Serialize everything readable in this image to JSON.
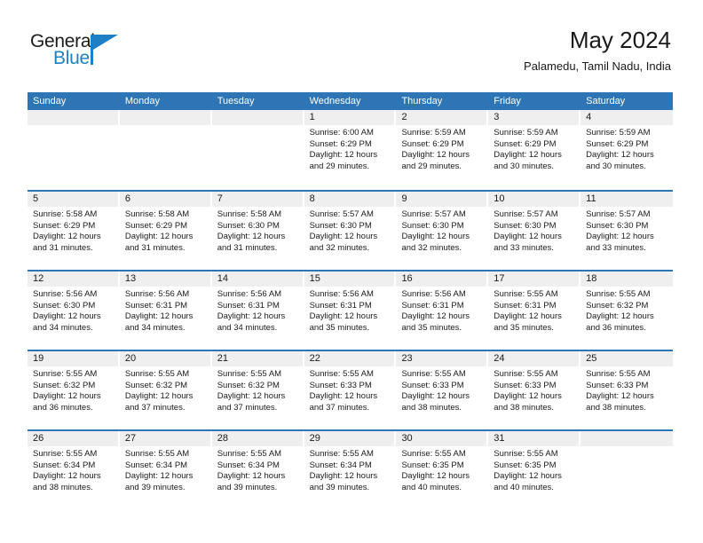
{
  "brand": {
    "name_top": "General",
    "name_bottom": "Blue",
    "accent_color": "#1f7fc4",
    "flag_icon": "triangle-flag-icon"
  },
  "header": {
    "title": "May 2024",
    "subtitle": "Palamedu, Tamil Nadu, India"
  },
  "theme": {
    "header_blue": "#2e75b6",
    "daynum_band": "#efefef",
    "text": "#1a1a1a"
  },
  "calendar": {
    "weekday_headers": [
      "Sunday",
      "Monday",
      "Tuesday",
      "Wednesday",
      "Thursday",
      "Friday",
      "Saturday"
    ],
    "weeks": [
      [
        {
          "day": "",
          "empty": true,
          "sunrise": "",
          "sunset": "",
          "daylight_line1": "",
          "daylight_line2": ""
        },
        {
          "day": "",
          "empty": true,
          "sunrise": "",
          "sunset": "",
          "daylight_line1": "",
          "daylight_line2": ""
        },
        {
          "day": "",
          "empty": true,
          "sunrise": "",
          "sunset": "",
          "daylight_line1": "",
          "daylight_line2": ""
        },
        {
          "day": "1",
          "sunrise": "Sunrise: 6:00 AM",
          "sunset": "Sunset: 6:29 PM",
          "daylight_line1": "Daylight: 12 hours",
          "daylight_line2": "and 29 minutes."
        },
        {
          "day": "2",
          "sunrise": "Sunrise: 5:59 AM",
          "sunset": "Sunset: 6:29 PM",
          "daylight_line1": "Daylight: 12 hours",
          "daylight_line2": "and 29 minutes."
        },
        {
          "day": "3",
          "sunrise": "Sunrise: 5:59 AM",
          "sunset": "Sunset: 6:29 PM",
          "daylight_line1": "Daylight: 12 hours",
          "daylight_line2": "and 30 minutes."
        },
        {
          "day": "4",
          "sunrise": "Sunrise: 5:59 AM",
          "sunset": "Sunset: 6:29 PM",
          "daylight_line1": "Daylight: 12 hours",
          "daylight_line2": "and 30 minutes."
        }
      ],
      [
        {
          "day": "5",
          "sunrise": "Sunrise: 5:58 AM",
          "sunset": "Sunset: 6:29 PM",
          "daylight_line1": "Daylight: 12 hours",
          "daylight_line2": "and 31 minutes."
        },
        {
          "day": "6",
          "sunrise": "Sunrise: 5:58 AM",
          "sunset": "Sunset: 6:29 PM",
          "daylight_line1": "Daylight: 12 hours",
          "daylight_line2": "and 31 minutes."
        },
        {
          "day": "7",
          "sunrise": "Sunrise: 5:58 AM",
          "sunset": "Sunset: 6:30 PM",
          "daylight_line1": "Daylight: 12 hours",
          "daylight_line2": "and 31 minutes."
        },
        {
          "day": "8",
          "sunrise": "Sunrise: 5:57 AM",
          "sunset": "Sunset: 6:30 PM",
          "daylight_line1": "Daylight: 12 hours",
          "daylight_line2": "and 32 minutes."
        },
        {
          "day": "9",
          "sunrise": "Sunrise: 5:57 AM",
          "sunset": "Sunset: 6:30 PM",
          "daylight_line1": "Daylight: 12 hours",
          "daylight_line2": "and 32 minutes."
        },
        {
          "day": "10",
          "sunrise": "Sunrise: 5:57 AM",
          "sunset": "Sunset: 6:30 PM",
          "daylight_line1": "Daylight: 12 hours",
          "daylight_line2": "and 33 minutes."
        },
        {
          "day": "11",
          "sunrise": "Sunrise: 5:57 AM",
          "sunset": "Sunset: 6:30 PM",
          "daylight_line1": "Daylight: 12 hours",
          "daylight_line2": "and 33 minutes."
        }
      ],
      [
        {
          "day": "12",
          "sunrise": "Sunrise: 5:56 AM",
          "sunset": "Sunset: 6:30 PM",
          "daylight_line1": "Daylight: 12 hours",
          "daylight_line2": "and 34 minutes."
        },
        {
          "day": "13",
          "sunrise": "Sunrise: 5:56 AM",
          "sunset": "Sunset: 6:31 PM",
          "daylight_line1": "Daylight: 12 hours",
          "daylight_line2": "and 34 minutes."
        },
        {
          "day": "14",
          "sunrise": "Sunrise: 5:56 AM",
          "sunset": "Sunset: 6:31 PM",
          "daylight_line1": "Daylight: 12 hours",
          "daylight_line2": "and 34 minutes."
        },
        {
          "day": "15",
          "sunrise": "Sunrise: 5:56 AM",
          "sunset": "Sunset: 6:31 PM",
          "daylight_line1": "Daylight: 12 hours",
          "daylight_line2": "and 35 minutes."
        },
        {
          "day": "16",
          "sunrise": "Sunrise: 5:56 AM",
          "sunset": "Sunset: 6:31 PM",
          "daylight_line1": "Daylight: 12 hours",
          "daylight_line2": "and 35 minutes."
        },
        {
          "day": "17",
          "sunrise": "Sunrise: 5:55 AM",
          "sunset": "Sunset: 6:31 PM",
          "daylight_line1": "Daylight: 12 hours",
          "daylight_line2": "and 35 minutes."
        },
        {
          "day": "18",
          "sunrise": "Sunrise: 5:55 AM",
          "sunset": "Sunset: 6:32 PM",
          "daylight_line1": "Daylight: 12 hours",
          "daylight_line2": "and 36 minutes."
        }
      ],
      [
        {
          "day": "19",
          "sunrise": "Sunrise: 5:55 AM",
          "sunset": "Sunset: 6:32 PM",
          "daylight_line1": "Daylight: 12 hours",
          "daylight_line2": "and 36 minutes."
        },
        {
          "day": "20",
          "sunrise": "Sunrise: 5:55 AM",
          "sunset": "Sunset: 6:32 PM",
          "daylight_line1": "Daylight: 12 hours",
          "daylight_line2": "and 37 minutes."
        },
        {
          "day": "21",
          "sunrise": "Sunrise: 5:55 AM",
          "sunset": "Sunset: 6:32 PM",
          "daylight_line1": "Daylight: 12 hours",
          "daylight_line2": "and 37 minutes."
        },
        {
          "day": "22",
          "sunrise": "Sunrise: 5:55 AM",
          "sunset": "Sunset: 6:33 PM",
          "daylight_line1": "Daylight: 12 hours",
          "daylight_line2": "and 37 minutes."
        },
        {
          "day": "23",
          "sunrise": "Sunrise: 5:55 AM",
          "sunset": "Sunset: 6:33 PM",
          "daylight_line1": "Daylight: 12 hours",
          "daylight_line2": "and 38 minutes."
        },
        {
          "day": "24",
          "sunrise": "Sunrise: 5:55 AM",
          "sunset": "Sunset: 6:33 PM",
          "daylight_line1": "Daylight: 12 hours",
          "daylight_line2": "and 38 minutes."
        },
        {
          "day": "25",
          "sunrise": "Sunrise: 5:55 AM",
          "sunset": "Sunset: 6:33 PM",
          "daylight_line1": "Daylight: 12 hours",
          "daylight_line2": "and 38 minutes."
        }
      ],
      [
        {
          "day": "26",
          "sunrise": "Sunrise: 5:55 AM",
          "sunset": "Sunset: 6:34 PM",
          "daylight_line1": "Daylight: 12 hours",
          "daylight_line2": "and 38 minutes."
        },
        {
          "day": "27",
          "sunrise": "Sunrise: 5:55 AM",
          "sunset": "Sunset: 6:34 PM",
          "daylight_line1": "Daylight: 12 hours",
          "daylight_line2": "and 39 minutes."
        },
        {
          "day": "28",
          "sunrise": "Sunrise: 5:55 AM",
          "sunset": "Sunset: 6:34 PM",
          "daylight_line1": "Daylight: 12 hours",
          "daylight_line2": "and 39 minutes."
        },
        {
          "day": "29",
          "sunrise": "Sunrise: 5:55 AM",
          "sunset": "Sunset: 6:34 PM",
          "daylight_line1": "Daylight: 12 hours",
          "daylight_line2": "and 39 minutes."
        },
        {
          "day": "30",
          "sunrise": "Sunrise: 5:55 AM",
          "sunset": "Sunset: 6:35 PM",
          "daylight_line1": "Daylight: 12 hours",
          "daylight_line2": "and 40 minutes."
        },
        {
          "day": "31",
          "sunrise": "Sunrise: 5:55 AM",
          "sunset": "Sunset: 6:35 PM",
          "daylight_line1": "Daylight: 12 hours",
          "daylight_line2": "and 40 minutes."
        },
        {
          "day": "",
          "empty": true,
          "sunrise": "",
          "sunset": "",
          "daylight_line1": "",
          "daylight_line2": ""
        }
      ]
    ]
  }
}
